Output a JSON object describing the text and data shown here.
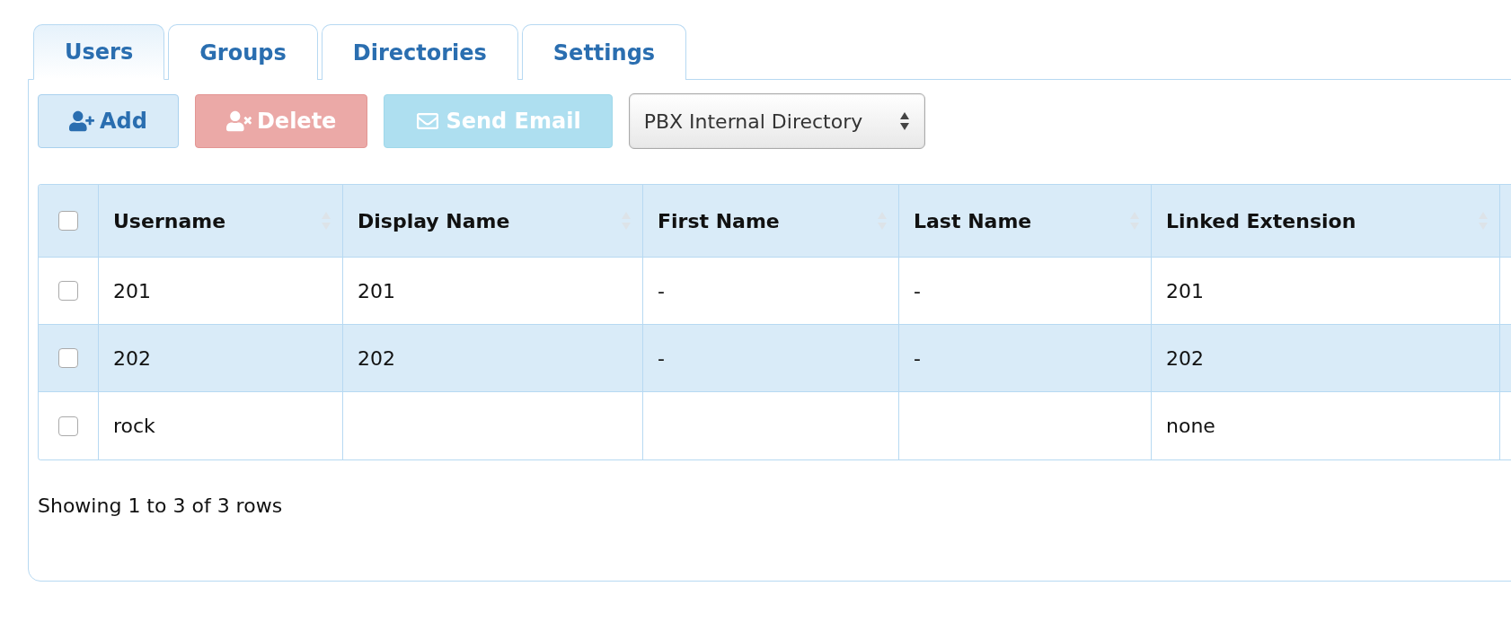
{
  "tabs": [
    {
      "label": "Users",
      "selected": true
    },
    {
      "label": "Groups",
      "selected": false
    },
    {
      "label": "Directories",
      "selected": false
    },
    {
      "label": "Settings",
      "selected": false
    }
  ],
  "toolbar": {
    "buttons": [
      {
        "label": "Add",
        "kind": "add",
        "disabled": false
      },
      {
        "label": "Delete",
        "kind": "delete",
        "disabled": true
      },
      {
        "label": "Send Email",
        "kind": "email",
        "disabled": true
      }
    ],
    "directory_select": {
      "value": "PBX Internal Directory"
    }
  },
  "table": {
    "select_all_checked": false,
    "columns": [
      "Username",
      "Display Name",
      "First Name",
      "Last Name",
      "Linked Extension"
    ],
    "rows": [
      {
        "checked": false,
        "highlighted": false,
        "cells": [
          "201",
          "201",
          "-",
          "-",
          "201"
        ]
      },
      {
        "checked": false,
        "highlighted": true,
        "cells": [
          "202",
          "202",
          "-",
          "-",
          "202"
        ]
      },
      {
        "checked": false,
        "highlighted": false,
        "cells": [
          "rock",
          "",
          "",
          "",
          "none"
        ]
      }
    ]
  },
  "footer": "Showing 1 to 3 of 3 rows"
}
